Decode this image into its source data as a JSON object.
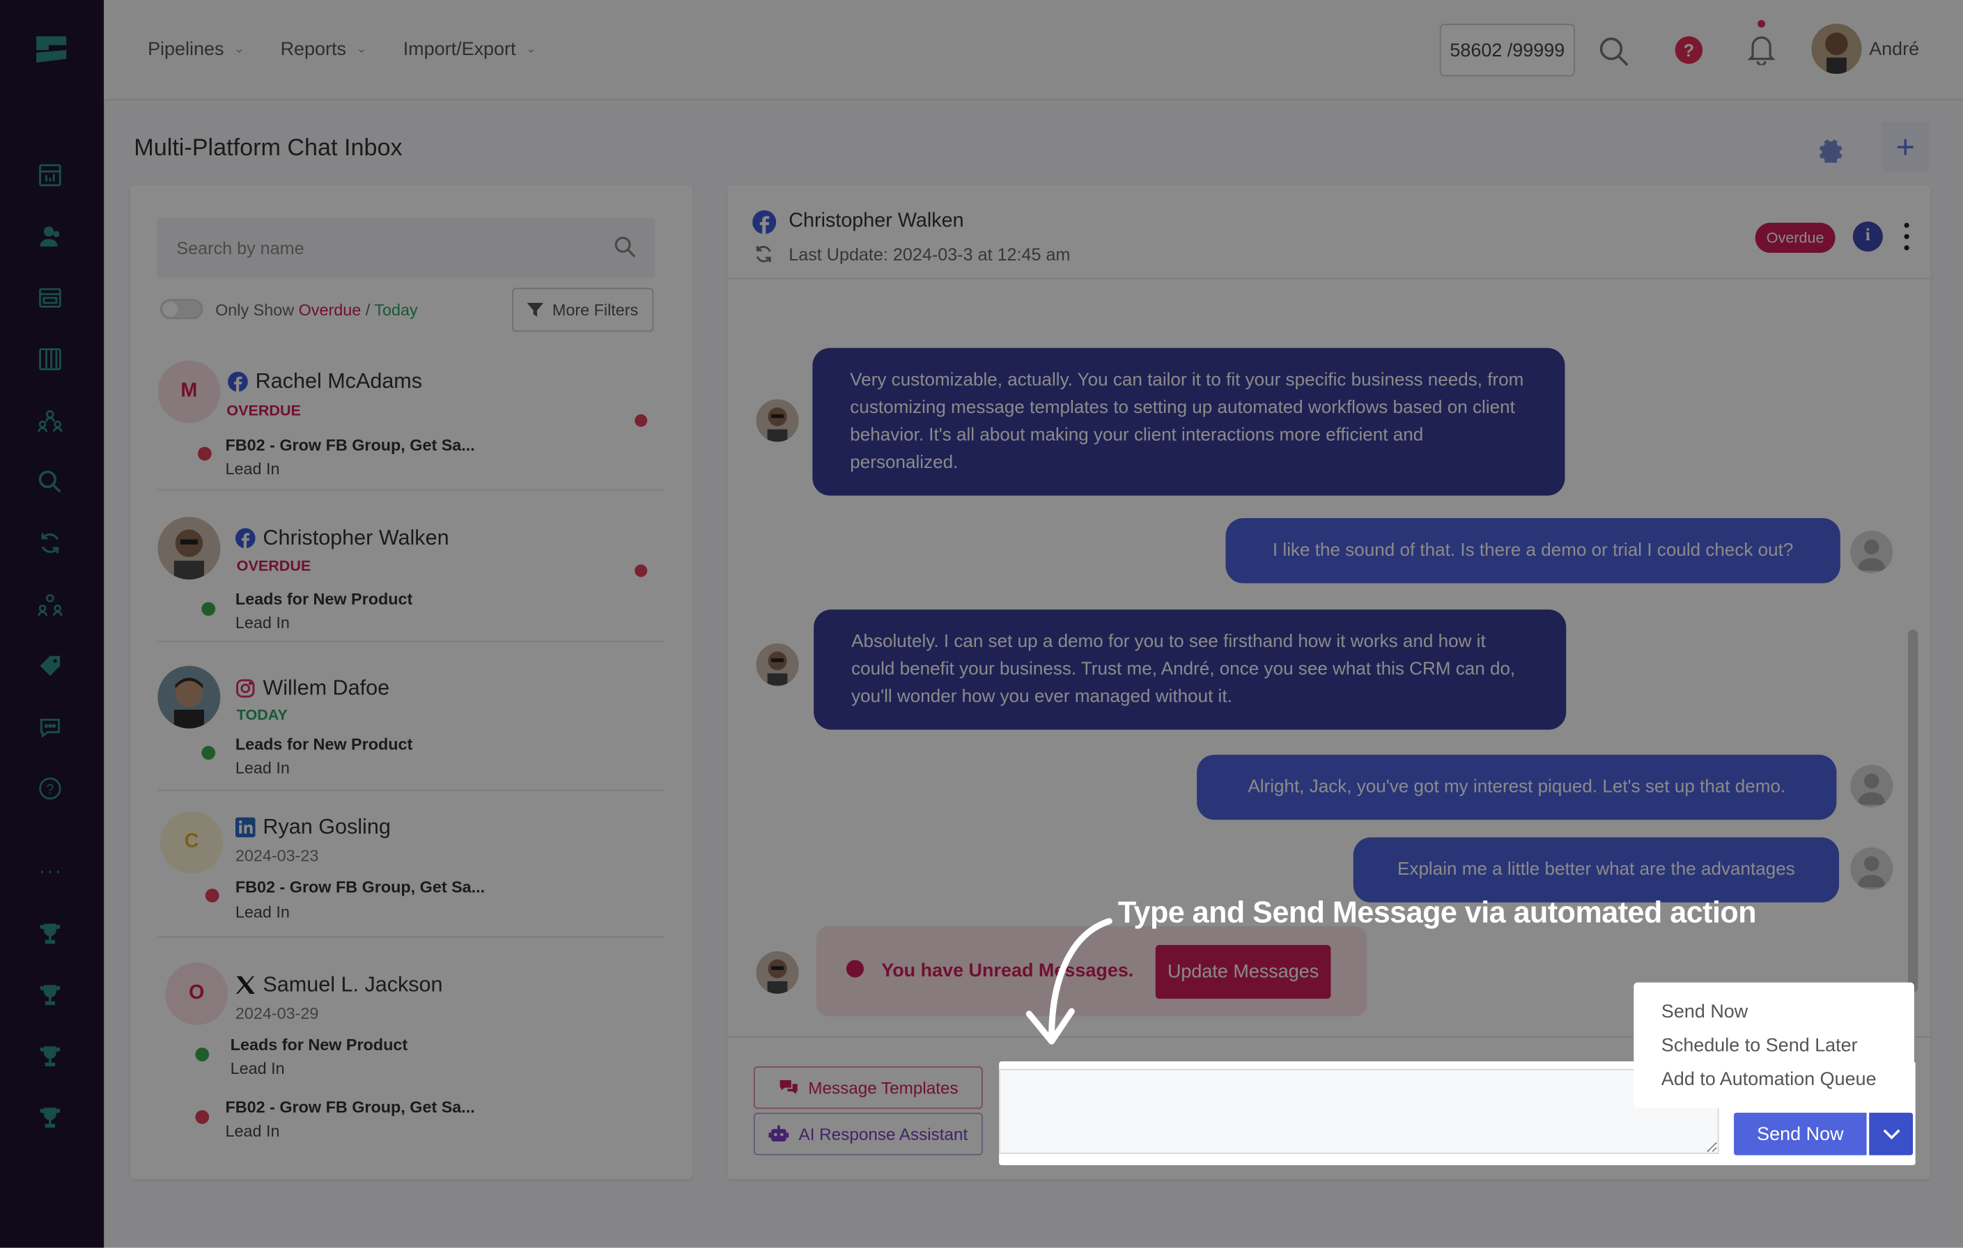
{
  "topbar": {
    "nav": [
      {
        "label": "Pipelines"
      },
      {
        "label": "Reports"
      },
      {
        "label": "Import/Export"
      }
    ],
    "counter": "58602 /99999",
    "user_name": "André",
    "icons": [
      "search-icon",
      "help-icon",
      "bell-icon"
    ]
  },
  "sidebar": {
    "icons": [
      "dashboard-icon",
      "contacts-icon",
      "inbox-icon",
      "pipeline-icon",
      "team-icon",
      "search-icon",
      "sync-icon",
      "users-icon",
      "tag-icon",
      "chat-icon",
      "help-icon",
      "more-icon",
      "trophy-icon",
      "trophy-icon",
      "trophy-icon",
      "trophy-icon"
    ],
    "more": "···"
  },
  "page": {
    "title": "Multi-Platform Chat Inbox"
  },
  "filters": {
    "search_placeholder": "Search by name",
    "toggle_prefix": "Only Show ",
    "overdue": "Overdue",
    "slash": " / ",
    "today": "Today",
    "more_filters": "More Filters"
  },
  "contacts": [
    {
      "initial": "M",
      "name": "Rachel McAdams",
      "platform": "facebook",
      "status": "OVERDUE",
      "deal": "FB02 - Grow FB Group, Get Sa...",
      "stage": "Lead In"
    },
    {
      "name": "Christopher Walken",
      "platform": "facebook",
      "status": "OVERDUE",
      "deal": "Leads for New Product",
      "stage": "Lead In"
    },
    {
      "name": "Willem Dafoe",
      "platform": "instagram",
      "status": "TODAY",
      "deal": "Leads for New Product",
      "stage": "Lead In"
    },
    {
      "initial": "C",
      "name": "Ryan Gosling",
      "platform": "linkedin",
      "date": "2024-03-23",
      "deal": "FB02 - Grow FB Group, Get Sa...",
      "stage": "Lead In"
    },
    {
      "initial": "O",
      "name": "Samuel L. Jackson",
      "platform": "x",
      "date": "2024-03-29",
      "deal": "Leads for New Product",
      "stage": "Lead In",
      "deal2": "FB02 - Grow FB Group, Get Sa...",
      "stage2": "Lead In"
    }
  ],
  "chat": {
    "name": "Christopher Walken",
    "last_update": "Last Update: 2024-03-3 at 12:45 am",
    "badge": "Overdue",
    "info": "i",
    "messages": [
      {
        "from": "contact",
        "text": "Very customizable, actually. You can tailor it to fit your specific business needs, from customizing message templates to setting up automated workflows based on client behavior. It's all about making your client interactions more efficient and personalized."
      },
      {
        "from": "user",
        "text": "I like the sound of that. Is there a demo or trial I could check out?"
      },
      {
        "from": "contact",
        "text": "Absolutely. I can set up a demo for you to see firsthand how it works and how it could benefit your business. Trust me, André, once you see what this CRM can do, you'll wonder how you ever managed without it."
      },
      {
        "from": "user",
        "text": "Alright, Jack, you've got my interest piqued. Let's set up that demo."
      },
      {
        "from": "user",
        "text": "Explain me a little better what are the advantages"
      }
    ],
    "unread_text": "You have Unread Messages.",
    "update_button": "Update Messages"
  },
  "composer": {
    "templates_button": "Message Templates",
    "ai_button": "AI Response Assistant",
    "send_button": "Send Now",
    "message_value": "",
    "menu": [
      "Send Now",
      "Schedule to Send Later",
      "Add to Automation Queue"
    ]
  },
  "annotation": "Type and Send Message via automated action",
  "colors": {
    "sidebar": "#1e1332",
    "accent": "#4e63dc",
    "incoming_bubble": "#3a3d99",
    "overdue": "#cf1e5a",
    "today": "#2fa36b"
  }
}
